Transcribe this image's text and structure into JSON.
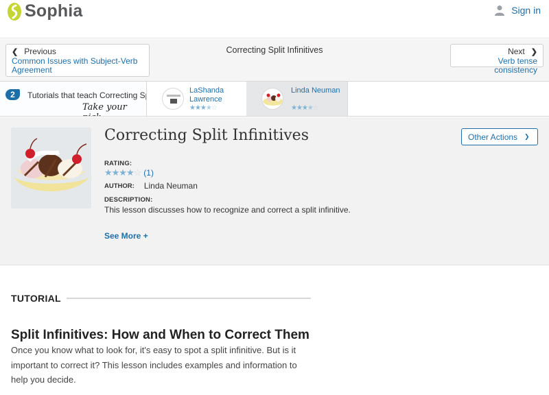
{
  "header": {
    "logo_text": "Sophia",
    "signin_label": "Sign in",
    "brand_color": "#c5d531"
  },
  "nav": {
    "prev_label": "Previous",
    "prev_link": "Common Issues with Subject-Verb Agreement",
    "current_title": "Correcting Split Infinitives",
    "next_label": "Next",
    "next_link": "Verb tense consistency"
  },
  "tutorials_strip": {
    "count": "2",
    "text": "Tutorials that teach Correcting Split Infinitives",
    "pick_text": "Take your pick:",
    "cards": [
      {
        "name": "LaShanda Lawrence",
        "rating": 3.5,
        "selected": false
      },
      {
        "name": "Linda Neuman",
        "rating": 3.5,
        "selected": true
      }
    ]
  },
  "lesson": {
    "title": "Correcting Split Infinitives",
    "other_actions_label": "Other Actions",
    "rating_label": "RATING:",
    "rating_stars": 4,
    "rating_count": "(1)",
    "author_label": "AUTHOR:",
    "author": "Linda Neuman",
    "description_label": "DESCRIPTION:",
    "description": "This lesson discusses how to recognize and correct a split infinitive.",
    "see_more_label": "See More +"
  },
  "tutorial": {
    "section_label": "TUTORIAL",
    "article_title": "Split Infinitives: How and When to Correct Them",
    "article_text": "Once you know what to look for, it's easy to spot a split infinitive. But is it important to correct it? This lesson includes examples and information to help you decide."
  }
}
